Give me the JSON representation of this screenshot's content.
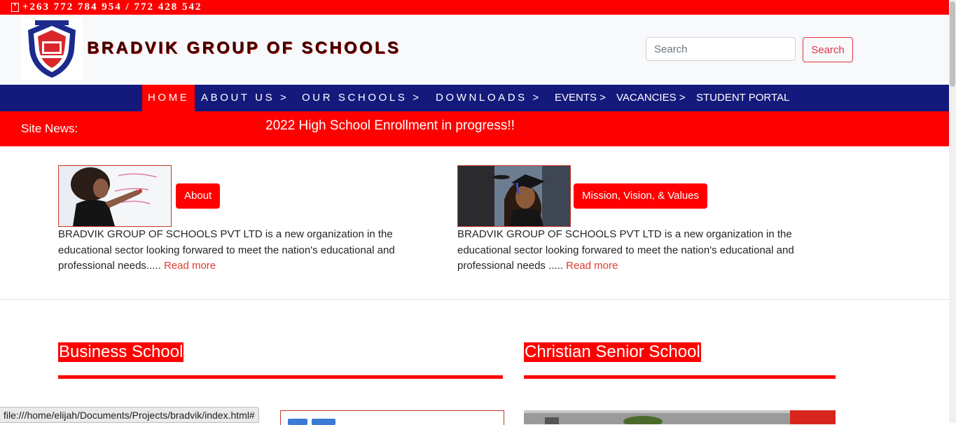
{
  "topbar": {
    "phone_icon": "phone-icon",
    "phones": "+263 772 784 954 / 772 428 542"
  },
  "header": {
    "brand": "BRADVIK GROUP OF SCHOOLS",
    "search_placeholder": "Search",
    "search_button": "Search"
  },
  "nav": {
    "items": [
      {
        "label": "HOME",
        "active": true
      },
      {
        "label": "ABOUT US >"
      },
      {
        "label": "OUR SCHOOLS >"
      },
      {
        "label": "DOWNLOADS >"
      },
      {
        "label": "EVENTS >"
      },
      {
        "label": "VACANCIES >"
      },
      {
        "label": "STUDENT PORTAL"
      }
    ]
  },
  "news": {
    "label": "Site News:",
    "text": "2022 High School Enrollment in progress!!"
  },
  "cards": [
    {
      "button": "About",
      "text": "BRADVIK GROUP OF SCHOOLS PVT LTD is a new organization in the educational sector looking forwared to meet the nation's educational and professional needs.....",
      "link": "Read more"
    },
    {
      "button": "Mission, Vision, & Values",
      "text": "BRADVIK GROUP OF SCHOOLS PVT LTD is a new organization in the educational sector looking forwared to meet the nation's educational and professional needs .....",
      "link": "Read more"
    }
  ],
  "sections": [
    {
      "title": "Business School"
    },
    {
      "title": "Christian Senior School"
    }
  ],
  "statusbar": {
    "url": "file:///home/elijah/Documents/Projects/bradvik/index.html#"
  },
  "colors": {
    "accent": "#ff0000",
    "nav_bg": "#141a7c",
    "link": "#e03c31",
    "outline_button": "#dc3545"
  }
}
